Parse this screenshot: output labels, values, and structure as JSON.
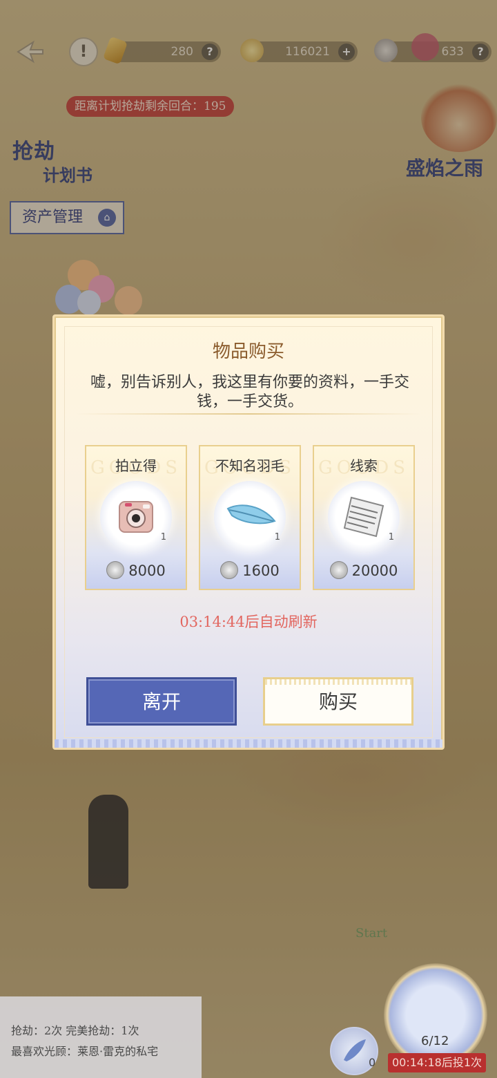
{
  "hud": {
    "resource_1_value": "280",
    "resource_2_value": "116021",
    "resource_3_value": "633",
    "help_symbol": "?",
    "add_symbol": "+",
    "alert_symbol": "!"
  },
  "banner": {
    "countdown_text": "距离计划抢劫剩余回合：195"
  },
  "plan_book": {
    "title_line1": "抢劫",
    "title_line2": "计划书"
  },
  "asset_button": {
    "label": "资产管理"
  },
  "event": {
    "title": "盛焰之雨"
  },
  "modal": {
    "title": "物品购买",
    "description": "嘘，别告诉别人，我这里有你要的资料，一手交钱，一手交货。",
    "watermark": "GOODS",
    "items": [
      {
        "name": "拍立得",
        "quantity": "1",
        "price": "8000",
        "icon": "instant-camera-icon"
      },
      {
        "name": "不知名羽毛",
        "quantity": "1",
        "price": "1600",
        "icon": "feather-icon"
      },
      {
        "name": "线索",
        "quantity": "1",
        "price": "20000",
        "icon": "document-icon"
      }
    ],
    "refresh_text": "03:14:44后自动刷新",
    "leave_label": "离开",
    "buy_label": "购买"
  },
  "map": {
    "start_label": "Start"
  },
  "bottom_info": {
    "robbery_stats": "抢劫：2次  完美抢劫：1次",
    "favorite_visit": "最喜欢光顾：莱恩·雷克的私宅"
  },
  "feather_counter": {
    "count": "0"
  },
  "dice": {
    "count": "6/12",
    "timer": "00:14:18后投1次"
  },
  "colors": {
    "accent_blue": "#5567b6",
    "alert_red": "#e2665f",
    "gold_border": "#e9cf8e"
  }
}
